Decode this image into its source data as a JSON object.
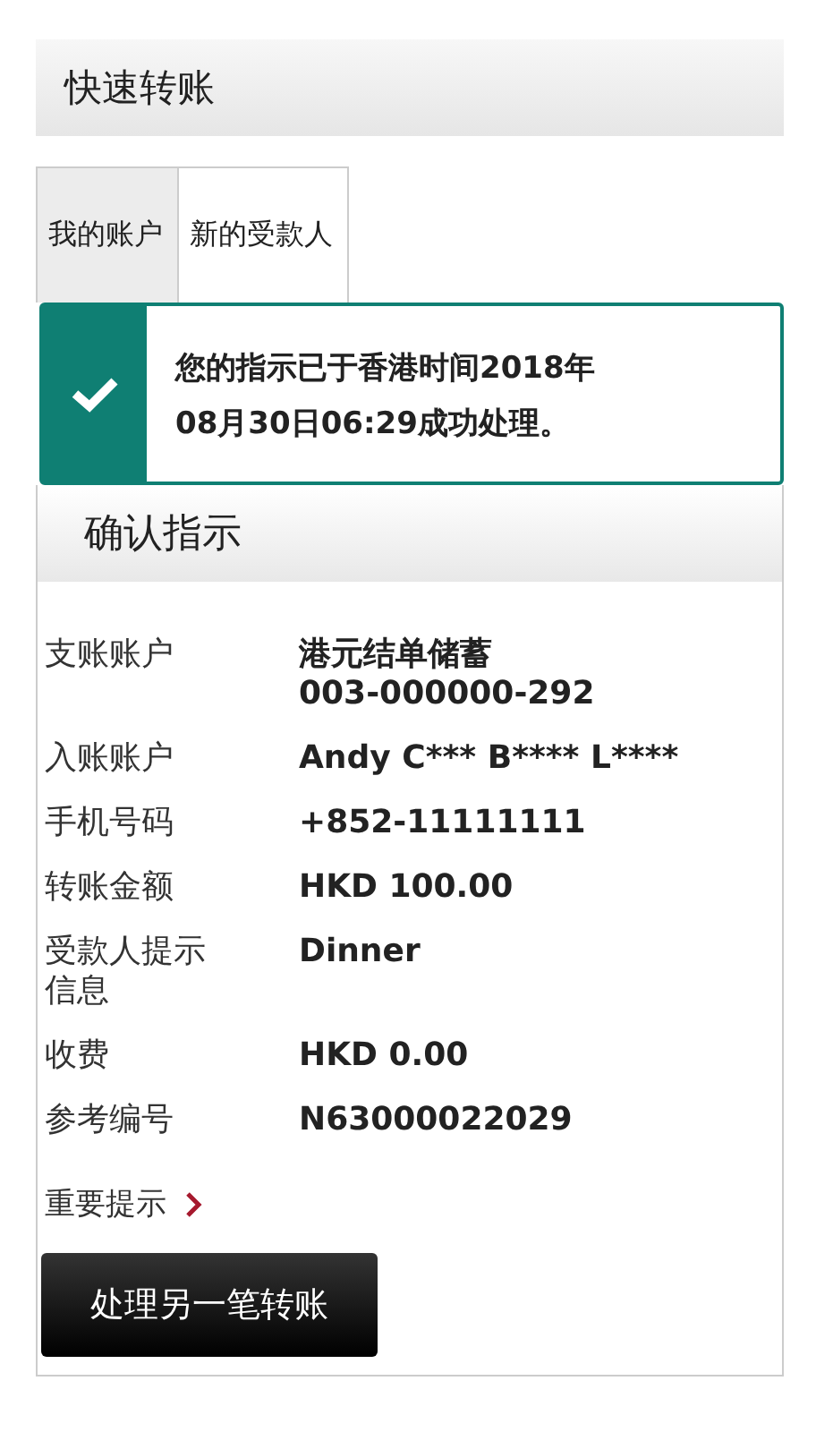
{
  "header": {
    "title": "快速转账"
  },
  "tabs": [
    {
      "label": "我的账户",
      "selected": false
    },
    {
      "label": "新的受款人",
      "selected": true
    }
  ],
  "alert": {
    "kind": "success",
    "lines": [
      "您的指示已于香港时间2018年",
      "08月30日06:29成功处理。"
    ]
  },
  "section": {
    "title": "确认指示"
  },
  "details": [
    {
      "label": "支账账户",
      "value_lines": [
        "港元结单储蓄",
        "003-000000-292"
      ]
    },
    {
      "label": "入账账户",
      "value_lines": [
        "Andy C*** B**** L****"
      ]
    },
    {
      "label": "手机号码",
      "value_lines": [
        "+852-11111111"
      ]
    },
    {
      "label": "转账金额",
      "value_lines": [
        "HKD 100.00"
      ]
    },
    {
      "label": "受款人提示信息",
      "value_lines": [
        "Dinner"
      ]
    },
    {
      "label": "收费",
      "value_lines": [
        "HKD 0.00"
      ]
    },
    {
      "label": "参考编号",
      "value_lines": [
        "N63000022029"
      ]
    }
  ],
  "link": {
    "label": "重要提示"
  },
  "button": {
    "label": "处理另一笔转账"
  }
}
